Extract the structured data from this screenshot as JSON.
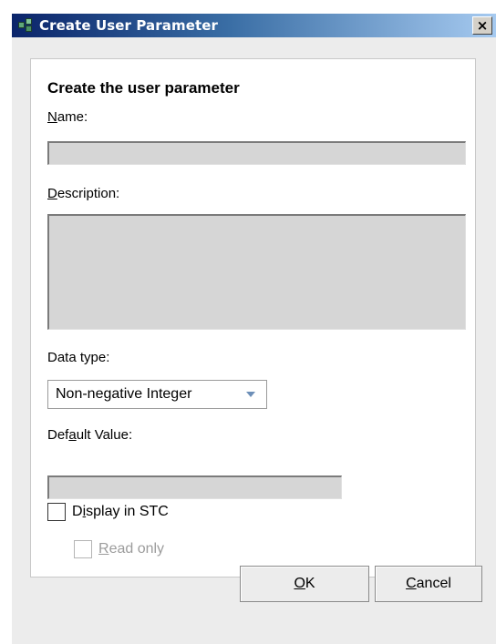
{
  "window": {
    "title": "Create User Parameter",
    "close_label": "×"
  },
  "form": {
    "heading": "Create the user parameter",
    "name_label_mnemonic": "N",
    "name_label_rest": "ame:",
    "name_value": "",
    "description_label_mnemonic": "D",
    "description_label_rest": "escription:",
    "description_value": "",
    "data_type_label": "Data type:",
    "data_type_selected": "Non-negative Integer",
    "default_value_label_pre": "Def",
    "default_value_label_mnemonic": "a",
    "default_value_label_rest": "ult Value:",
    "default_value": "",
    "display_in_stc_pre": "D",
    "display_in_stc_mnemonic": "i",
    "display_in_stc_rest": "splay in STC",
    "display_in_stc_checked": false,
    "read_only_mnemonic": "R",
    "read_only_rest": "ead only",
    "read_only_checked": false,
    "read_only_enabled": false
  },
  "buttons": {
    "ok_mnemonic": "O",
    "ok_rest": "K",
    "cancel_mnemonic": "C",
    "cancel_rest": "ancel"
  },
  "icons": {
    "title_icon": "app-cubes-icon",
    "close_icon": "close-icon",
    "dropdown_icon": "chevron-down-icon"
  },
  "colors": {
    "titlebar_start": "#0a246a",
    "titlebar_end": "#a6caf0",
    "field_bg": "#d6d6d6",
    "dialog_bg": "#ececec",
    "dropdown_arrow": "#6d8fb8"
  }
}
